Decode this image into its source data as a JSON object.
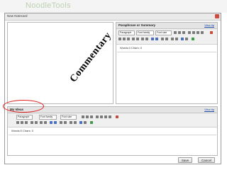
{
  "app": {
    "logo_text": "NoodleTools",
    "logo_tagline": ""
  },
  "window": {
    "title": "New Notecard"
  },
  "paraphrase": {
    "title": "Paraphrase or Summary",
    "help_link": "View tip",
    "toolbar": {
      "format": "Paragraph",
      "font_family": "Font family",
      "font_size": "Font size"
    },
    "word_count": "Words:0 Chars: 0"
  },
  "my_ideas": {
    "title": "My Ideas",
    "help_link": "View tip",
    "toolbar": {
      "format": "Paragraph",
      "font_family": "Font family",
      "font_size": "Font size"
    },
    "word_count": "Words:0 Chars: 0"
  },
  "overlay": {
    "commentary_text": "Commentary",
    "highlight_color": "#e02020"
  },
  "footer": {
    "save_label": "Save",
    "cancel_label": "Cancel"
  }
}
